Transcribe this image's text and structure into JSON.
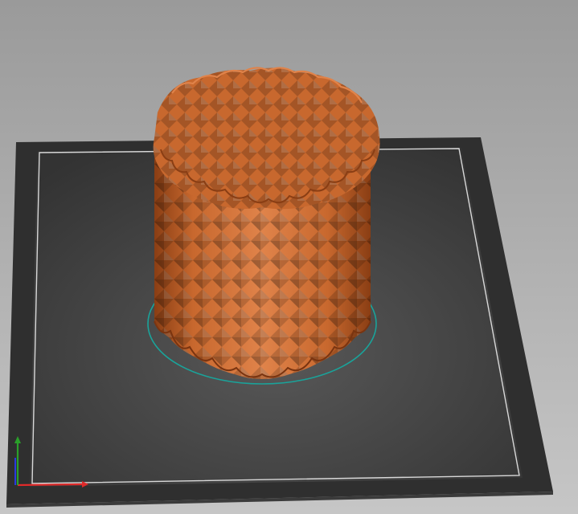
{
  "viewport": {
    "background_top": "#9a9a9a",
    "background_bottom": "#c6c6c6"
  },
  "bed": {
    "color": "#2f2f2f",
    "bevel_color": "#3b3b3b",
    "surface_center": "#585858",
    "surface_edge": "#333333",
    "border_color": "#d8d8d8"
  },
  "model": {
    "shape": "textured-cylinder-vase",
    "color": "#c8682e",
    "shade_color": "#8a3e14",
    "highlight_color": "#e0834a",
    "footprint_color": "#1aa39a"
  },
  "axes": {
    "x_color": "#e02a2a",
    "y_color": "#2aa02a",
    "z_color": "#2a3ae0"
  }
}
